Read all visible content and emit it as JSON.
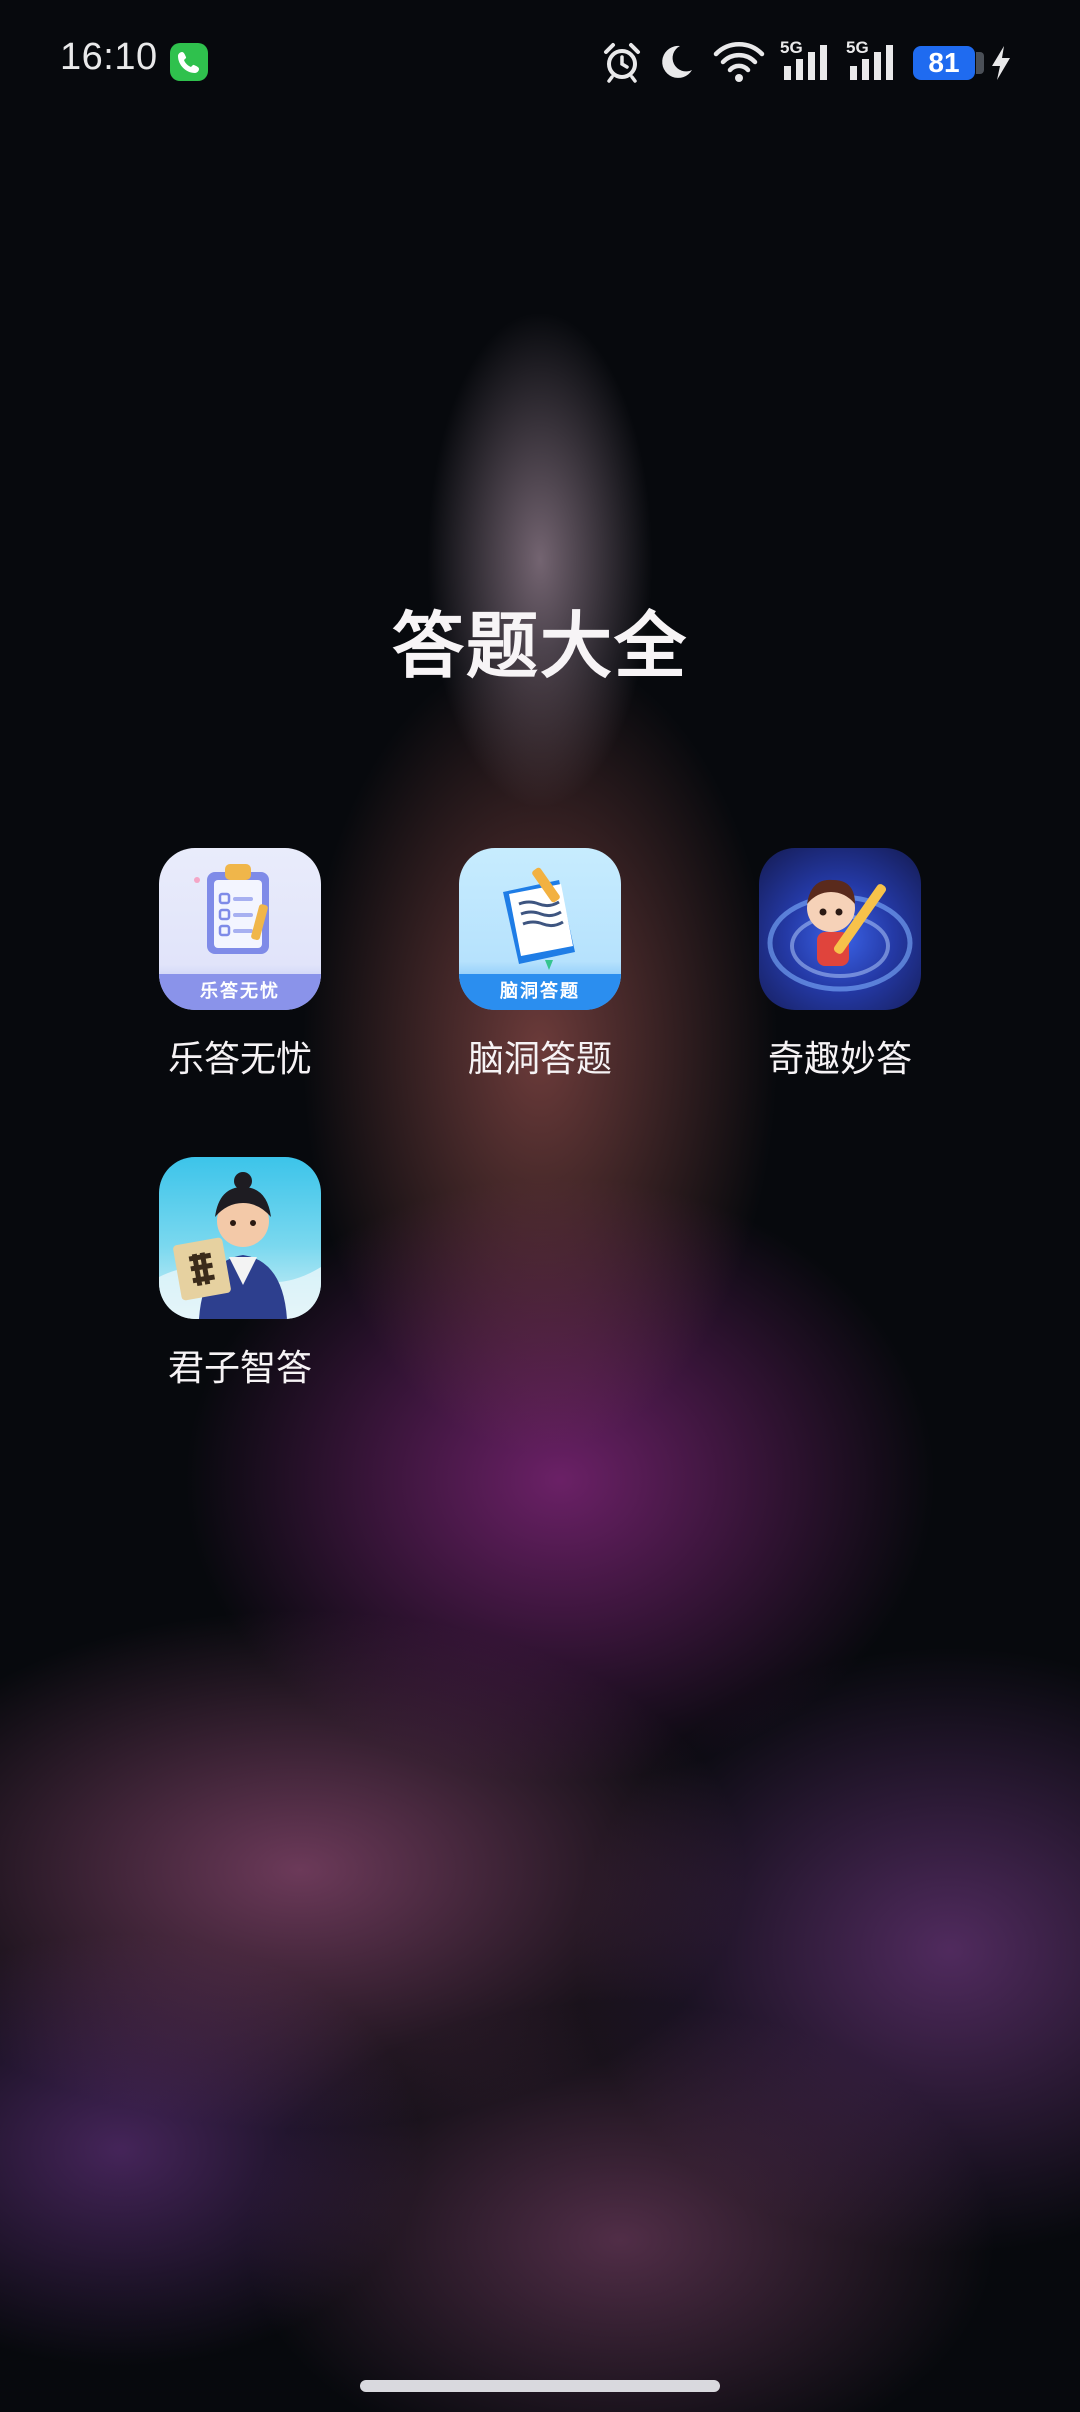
{
  "status_bar": {
    "time": "16:10",
    "network_1": "5G",
    "network_2": "5G",
    "battery": "81"
  },
  "folder": {
    "title": "答题大全",
    "apps": [
      {
        "label": "乐答无忧",
        "badge": "乐答无忧",
        "icon": "clipboard-checklist-icon"
      },
      {
        "label": "脑洞答题",
        "badge": "脑洞答题",
        "icon": "book-pencil-icon"
      },
      {
        "label": "奇趣妙答",
        "icon": "cartoon-boy-pencil-icon"
      },
      {
        "label": "君子智答",
        "icon": "scholar-scroll-icon"
      }
    ]
  },
  "colors": {
    "battery_fill": "#1f6bf0",
    "phone_badge": "#2fc14d"
  }
}
